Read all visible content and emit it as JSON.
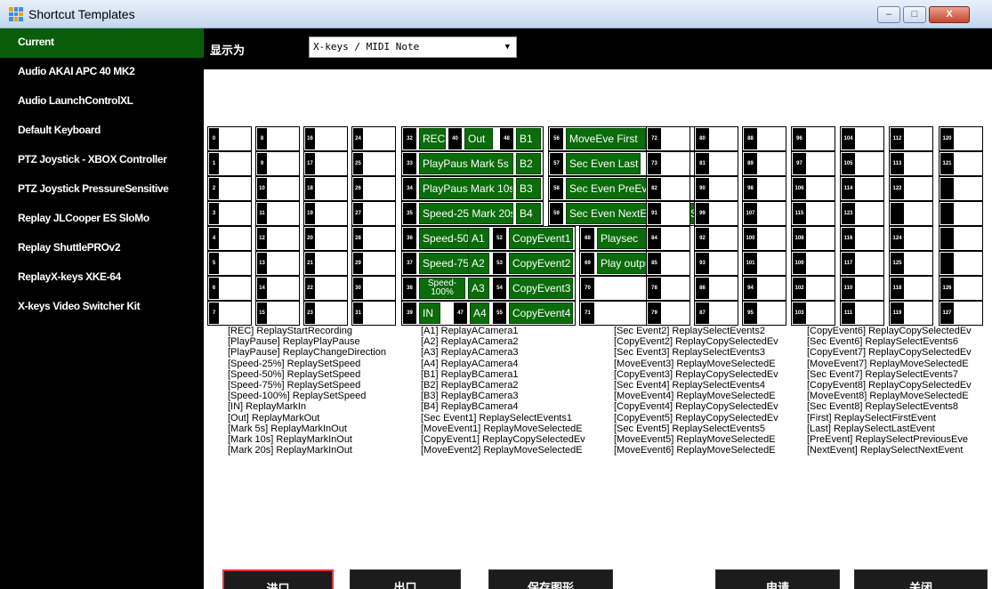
{
  "window": {
    "title": "Shortcut Templates",
    "min": "–",
    "max": "□",
    "close": "X"
  },
  "sidebar": {
    "items": [
      "Current",
      "Audio AKAI APC 40 MK2",
      "Audio LaunchControlXL",
      "Default Keyboard",
      "PTZ Joystick - XBOX Controller",
      "PTZ Joystick PressureSensitive",
      "Replay JLCooper ES SloMo",
      "Replay ShuttlePROv2",
      "ReplayX-keys XKE-64",
      "X-keys Video Switcher Kit"
    ]
  },
  "display": {
    "label": "显示为",
    "value": "X-keys / MIDI Note"
  },
  "keys": {
    "col0": [
      {
        "n": "0"
      },
      {
        "n": "1"
      },
      {
        "n": "2"
      },
      {
        "n": "3"
      },
      {
        "n": "4"
      },
      {
        "n": "5"
      },
      {
        "n": "6"
      },
      {
        "n": "7"
      }
    ],
    "col1": [
      {
        "n": "8"
      },
      {
        "n": "9"
      },
      {
        "n": "10"
      },
      {
        "n": "11"
      },
      {
        "n": "12"
      },
      {
        "n": "13"
      },
      {
        "n": "14"
      },
      {
        "n": "15"
      }
    ],
    "col2": [
      {
        "n": "16"
      },
      {
        "n": "17"
      },
      {
        "n": "18"
      },
      {
        "n": "19"
      },
      {
        "n": "20"
      },
      {
        "n": "21"
      },
      {
        "n": "22"
      },
      {
        "n": "23"
      }
    ],
    "col3": [
      {
        "n": "24"
      },
      {
        "n": "25"
      },
      {
        "n": "26"
      },
      {
        "n": "27"
      },
      {
        "n": "28"
      },
      {
        "n": "29"
      },
      {
        "n": "30"
      },
      {
        "n": "31"
      }
    ],
    "r0": {
      "n32": "32",
      "b32": "REC",
      "n40": "40",
      "b40": "Out",
      "n48": "48",
      "b48": "B1",
      "n56": "56",
      "b56": "MoveEve First"
    },
    "r1": {
      "n33": "33",
      "b33": "PlayPaus Mark 5s",
      "b41": "B2",
      "n57": "57",
      "b57": "Sec Even Last"
    },
    "r2": {
      "n34": "34",
      "b34": "PlayPaus Mark 10s",
      "b42": "B3",
      "n58": "58",
      "b58": "Sec Even PreEvent"
    },
    "r3": {
      "n35": "35",
      "b35": "Speed-25 Mark 20s",
      "b43": "B4",
      "n59": "59",
      "b59": "Sec Even NextEver REC Stop"
    },
    "r4": {
      "n36": "36",
      "b36": "Speed-50",
      "b44": "A1",
      "n52": "52",
      "b52": "CopyEvent1",
      "n68": "68",
      "b68": "Playsec"
    },
    "r5": {
      "n37": "37",
      "b37": "Speed-75",
      "b45": "A2",
      "n53": "53",
      "b53": "CopyEvent2",
      "n69": "69",
      "b69": "Play outpu"
    },
    "r6": {
      "n38": "38",
      "b38": "Speed-100%",
      "b46": "A3",
      "n54": "54",
      "b54": "CopyEvent3",
      "n70": "70"
    },
    "r7": {
      "n39": "39",
      "b39": "IN",
      "n47": "47",
      "b47": "A4",
      "n55": "55",
      "b55": "CopyEvent4",
      "n71": "71"
    },
    "col8": [
      "72",
      "73",
      "82",
      "91",
      "84",
      "85",
      "78",
      "79"
    ],
    "col9": [
      "80",
      "81",
      "90",
      "99",
      "92",
      "93",
      "86",
      "87"
    ],
    "col10": [
      "88",
      "89",
      "98",
      "107",
      "100",
      "101",
      "94",
      "95"
    ],
    "col11": [
      "96",
      "97",
      "106",
      "115",
      "108",
      "109",
      "102",
      "103"
    ],
    "col12": [
      "104",
      "105",
      "114",
      "123",
      "116",
      "117",
      "110",
      "111"
    ],
    "col13": [
      "112",
      "113",
      "122",
      "",
      "124",
      "125",
      "118",
      "119"
    ],
    "col14": [
      "120",
      "121",
      "",
      "",
      "",
      "",
      "126",
      "127"
    ]
  },
  "legend": {
    "c1": [
      "[REC] ReplayStartRecording",
      "[PlayPause] ReplayPlayPause",
      "[PlayPause] ReplayChangeDirection",
      "[Speed-25%] ReplaySetSpeed",
      "[Speed-50%] ReplaySetSpeed",
      "[Speed-75%] ReplaySetSpeed",
      "[Speed-100%] ReplaySetSpeed",
      "[IN] ReplayMarkIn",
      "[Out] ReplayMarkOut",
      "[Mark 5s] ReplayMarkInOut",
      "[Mark 10s] ReplayMarkInOut",
      "[Mark 20s] ReplayMarkInOut"
    ],
    "c2": [
      "[A1] ReplayACamera1",
      "[A2] ReplayACamera2",
      "[A3] ReplayACamera3",
      "[A4] ReplayACamera4",
      "[B1] ReplayBCamera1",
      "[B2] ReplayBCamera2",
      "[B3] ReplayBCamera3",
      "[B4] ReplayBCamera4",
      "[Sec Event1] ReplaySelectEvents1",
      "[MoveEvent1] ReplayMoveSelectedE",
      "[CopyEvent1] ReplayCopySelectedEv",
      "[MoveEvent2] ReplayMoveSelectedE"
    ],
    "c3": [
      "[Sec Event2] ReplaySelectEvents2",
      "[CopyEvent2] ReplayCopySelectedEv",
      "[Sec Event3] ReplaySelectEvents3",
      "[MoveEvent3] ReplayMoveSelectedE",
      "[CopyEvent3] ReplayCopySelectedEv",
      "[Sec Event4] ReplaySelectEvents4",
      "[MoveEvent4] ReplayMoveSelectedE",
      "[CopyEvent4] ReplayCopySelectedEv",
      "[CopyEvent5] ReplayCopySelectedEv",
      "[Sec Event5] ReplaySelectEvents5",
      "[MoveEvent5] ReplayMoveSelectedE",
      "[MoveEvent6] ReplayMoveSelectedE"
    ],
    "c4": [
      "[CopyEvent6] ReplayCopySelectedEv",
      "[Sec Event6] ReplaySelectEvents6",
      "[CopyEvent7] ReplayCopySelectedEv",
      "[MoveEvent7] ReplayMoveSelectedE",
      "[Sec Event7] ReplaySelectEvents7",
      "[CopyEvent8] ReplayCopySelectedEv",
      "[MoveEvent8] ReplayMoveSelectedE",
      "[Sec Event8] ReplaySelectEvents8",
      "[First] ReplaySelectFirstEvent",
      "[Last] ReplaySelectLastEvent",
      "[PreEvent] ReplaySelectPreviousEve",
      "[NextEvent] ReplaySelectNextEvent"
    ]
  },
  "buttons": {
    "import": "进口",
    "export": "出口",
    "save": "保存图形",
    "apply": "申请",
    "close": "关闭"
  },
  "colors": {
    "accent_green": "#0a6c0a",
    "highlight_red": "#e03a3a"
  }
}
